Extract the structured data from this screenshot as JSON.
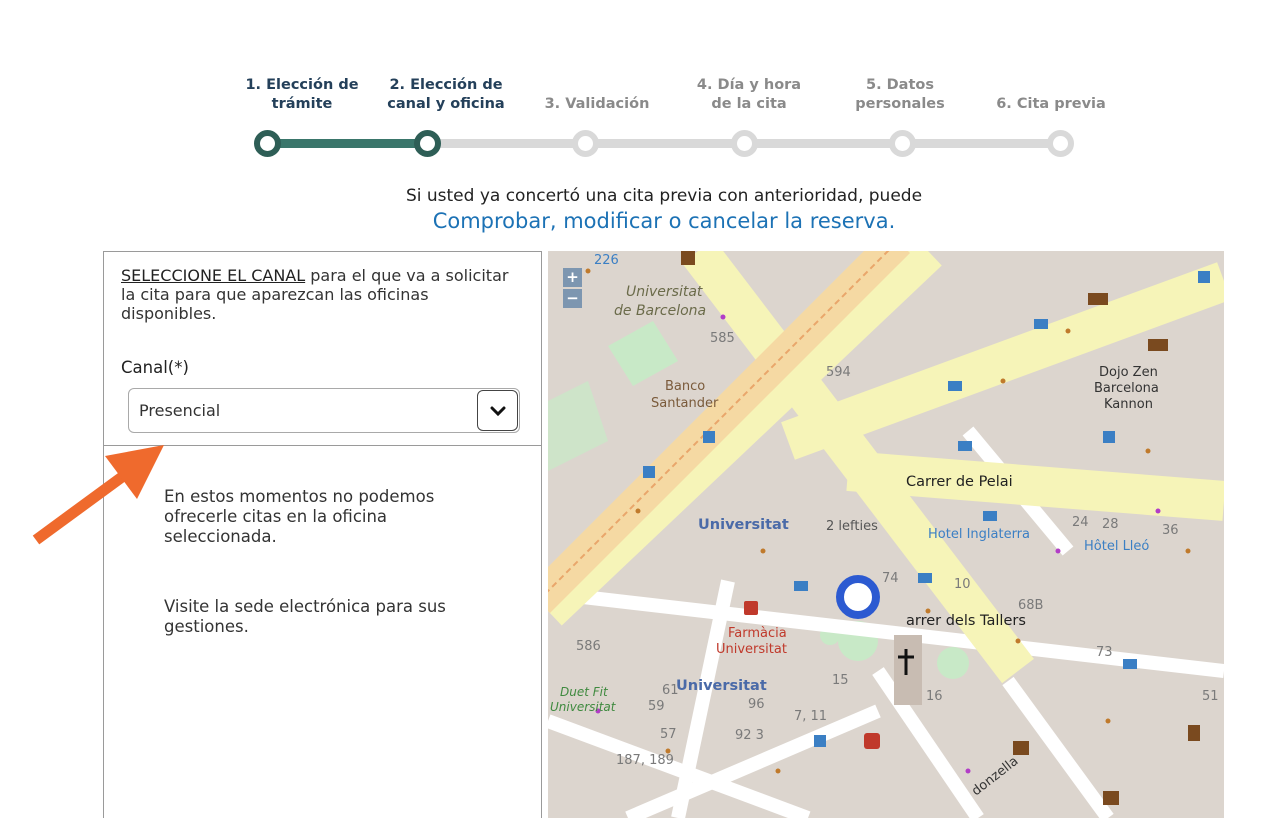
{
  "stepper": {
    "steps": [
      {
        "line1": "1. Elección de",
        "line2": "trámite"
      },
      {
        "line1": "2. Elección de",
        "line2": "canal y oficina"
      },
      {
        "line1": "3. Validación",
        "line2": ""
      },
      {
        "line1": "4. Día y hora",
        "line2": "de la cita"
      },
      {
        "line1": "5. Datos",
        "line2": "personales"
      },
      {
        "line1": "6. Cita previa",
        "line2": ""
      }
    ],
    "current_step": 2,
    "active_color": "#2e5e56",
    "inactive_color": "#d9d9d9"
  },
  "info": {
    "text": "Si usted ya concertó una cita previa con anterioridad, puede",
    "link": "Comprobar, modificar o cancelar la reserva",
    "link_suffix": "."
  },
  "form": {
    "instruction_link": "SELECCIONE EL CANAL",
    "instruction_rest": " para el que va a solicitar la cita para que aparezcan las oficinas disponibles.",
    "canal_label": "Canal(*)",
    "canal_value": "Presencial",
    "message1": "En estos momentos no podemos ofrecerle citas en la oficina seleccionada.",
    "message2": "Visite la sede electrónica para sus gestiones."
  },
  "map": {
    "zoom_in": "+",
    "zoom_out": "−",
    "labels": {
      "univ1": "Universitat",
      "univ2": "de Barcelona",
      "banco1": "Banco",
      "banco2": "Santander",
      "dojo1": "Dojo Zen",
      "dojo2": "Barcelona",
      "dojo3": "Kannon",
      "pelai": "Carrer de Pelai",
      "universitat": "Universitat",
      "lefties": "2 lefties",
      "inglaterra": "Hotel Inglaterra",
      "lleo": "Hôtel Lleó",
      "tallers": "arrer dels Tallers",
      "farmacia1": "Farmàcia",
      "farmacia2": "Universitat",
      "universitat2": "Universitat",
      "duet1": "Duet Fit",
      "duet2": "Universitat",
      "doncella": "donzella",
      "n226": "226",
      "n585": "585",
      "n594": "594",
      "n586": "586",
      "n68b": "68B",
      "n73": "73",
      "n187": "187, 189",
      "n711": "7, 11",
      "n92": "92 3",
      "n96": "96",
      "n74": "74",
      "n10": "10",
      "n16": "16",
      "n15": "15",
      "n51": "51",
      "n57": "57",
      "n59": "59",
      "n61": "61",
      "n36": "36",
      "n24": "24",
      "n28": "28"
    },
    "marker_color": "#2c5ad1"
  },
  "colors": {
    "link": "#1c72b5",
    "arrow": "#ef6a2d",
    "road_yellow": "#f6f4b8",
    "road_orange": "#f5d9a3",
    "park": "#c8e9c7"
  }
}
